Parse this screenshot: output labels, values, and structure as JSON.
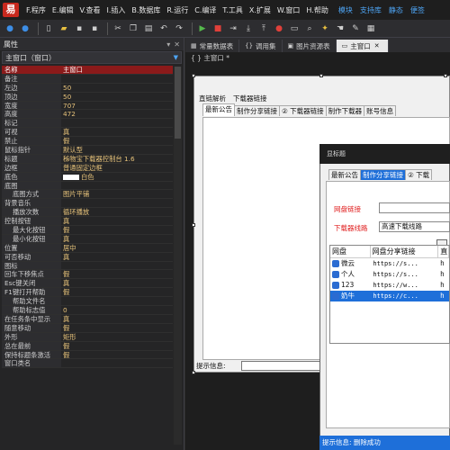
{
  "logo": "易",
  "menubar": {
    "items": [
      "F.程序",
      "E.编辑",
      "V.查看",
      "I.插入",
      "B.数据库",
      "R.运行",
      "C.编译",
      "T.工具",
      "X.扩展",
      "W.窗口",
      "H.帮助"
    ],
    "extras": [
      "模块",
      "支持库",
      "静态",
      "便签"
    ]
  },
  "toolbar": {
    "icons": [
      "back-icon",
      "forward-icon",
      "new-icon",
      "open-icon",
      "save-icon",
      "save-all-icon",
      "cut-icon",
      "copy-icon",
      "paste-icon",
      "undo-icon",
      "redo-icon",
      "run-icon",
      "stop-icon",
      "step-icon",
      "step-into-icon",
      "step-out-icon",
      "breakpoint-icon",
      "bookmark-icon",
      "find-icon",
      "lightbulb-icon",
      "hand-icon",
      "edit-icon",
      "grid-icon"
    ]
  },
  "props": {
    "title": "属性",
    "selected_object": "主窗口（窗口）",
    "rows": [
      {
        "k": "名称",
        "v": "主窗口",
        "sel": true
      },
      {
        "k": "备注",
        "v": ""
      },
      {
        "k": "左边",
        "v": "50"
      },
      {
        "k": "顶边",
        "v": "50"
      },
      {
        "k": "宽度",
        "v": "707"
      },
      {
        "k": "高度",
        "v": "472"
      },
      {
        "k": "标记",
        "v": ""
      },
      {
        "k": "可视",
        "v": "真"
      },
      {
        "k": "禁止",
        "v": "假"
      },
      {
        "k": "鼠标指针",
        "v": "默认型"
      },
      {
        "k": "标题",
        "v": "秭物宝下载器控制台  1.6"
      },
      {
        "k": "边框",
        "v": "普通固定边框"
      },
      {
        "k": "底色",
        "v": "白色",
        "swatch": true
      },
      {
        "k": "底图",
        "v": ""
      },
      {
        "k": "底图方式",
        "v": "图片平铺",
        "ind": true
      },
      {
        "k": "背景音乐",
        "v": ""
      },
      {
        "k": "播放次数",
        "v": "循环播放",
        "ind": true
      },
      {
        "k": "控制按钮",
        "v": "真"
      },
      {
        "k": "最大化按钮",
        "v": "假",
        "ind": true
      },
      {
        "k": "最小化按钮",
        "v": "真",
        "ind": true
      },
      {
        "k": "位置",
        "v": "居中"
      },
      {
        "k": "可否移动",
        "v": "真"
      },
      {
        "k": "图标",
        "v": ""
      },
      {
        "k": "回车下移焦点",
        "v": "假"
      },
      {
        "k": "Esc键关闭",
        "v": "真"
      },
      {
        "k": "F1键打开帮助",
        "v": "假"
      },
      {
        "k": "帮助文件名",
        "v": "",
        "ind": true
      },
      {
        "k": "帮助标志值",
        "v": "0",
        "ind": true
      },
      {
        "k": "在任务条中显示",
        "v": "真"
      },
      {
        "k": "随意移动",
        "v": "假"
      },
      {
        "k": "外形",
        "v": "矩形"
      },
      {
        "k": "总在最前",
        "v": "假"
      },
      {
        "k": "保持标题条激活",
        "v": "假"
      },
      {
        "k": "窗口类名",
        "v": ""
      }
    ]
  },
  "tabs": [
    {
      "label": "常量数据表",
      "icon": "table-icon"
    },
    {
      "label": "调用集",
      "icon": "braces-icon"
    },
    {
      "label": "图片资源表",
      "icon": "image-icon"
    },
    {
      "label": "主窗口",
      "icon": "window-icon",
      "active": true
    }
  ],
  "designer": {
    "title": "主窗口 *",
    "form1": {
      "menu": [
        "直链解析",
        "下载器链接"
      ],
      "tabs": [
        "最新公告",
        "制作分享链接",
        "② 下载器链接",
        "制作下载器",
        "账号信息"
      ],
      "status_label": "提示信息:"
    },
    "form2": {
      "title": "显标题",
      "tabs": [
        "最新公告",
        "制作分享链接",
        "② 下载"
      ],
      "label1": "网盘链接",
      "label2": "下载器线路",
      "input2": "高速下载线路",
      "list_headers": [
        "网盘",
        "网盘分享链接",
        "直"
      ],
      "list_rows": [
        {
          "name": "微云",
          "link": "https://s...",
          "c3": "h"
        },
        {
          "name": "个人",
          "link": "https://s...",
          "c3": "h"
        },
        {
          "name": "123",
          "link": "https://w...",
          "c3": "h"
        },
        {
          "name": "奶牛",
          "link": "https://c...",
          "c3": "h",
          "sel": true
        }
      ],
      "status": "提示信息:   删除成功"
    }
  }
}
